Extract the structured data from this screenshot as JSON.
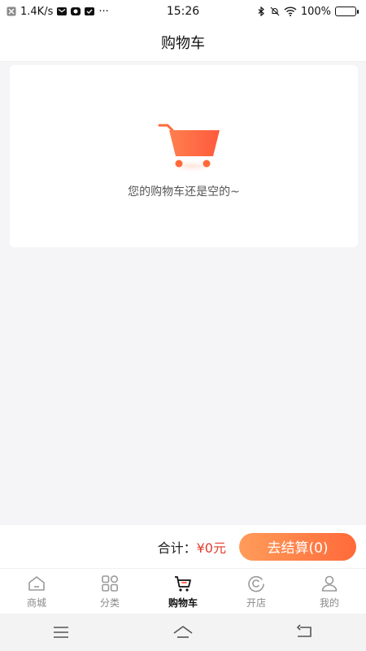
{
  "status_bar": {
    "network_speed": "1.4K/s",
    "time": "15:26",
    "battery": "100%",
    "more": "···"
  },
  "header": {
    "title": "购物车"
  },
  "empty_state": {
    "message": "您的购物车还是空的~"
  },
  "checkout": {
    "total_label": "合计：",
    "total_value": "¥0元",
    "button_label": "去结算(0)"
  },
  "tabs": [
    {
      "label": "商城",
      "icon": "home-icon",
      "active": false
    },
    {
      "label": "分类",
      "icon": "category-icon",
      "active": false
    },
    {
      "label": "购物车",
      "icon": "cart-icon",
      "active": true
    },
    {
      "label": "开店",
      "icon": "shop-icon",
      "active": false
    },
    {
      "label": "我的",
      "icon": "profile-icon",
      "active": false
    }
  ],
  "colors": {
    "accent_start": "#ff9c5a",
    "accent_end": "#ff6a3a",
    "price_red": "#e23b2e"
  }
}
